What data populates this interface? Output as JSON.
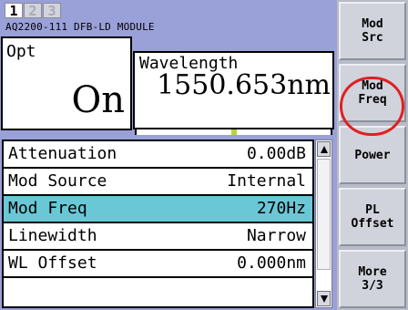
{
  "tabs": [
    {
      "label": "1",
      "active": true
    },
    {
      "label": "2",
      "active": false
    },
    {
      "label": "3",
      "active": false
    }
  ],
  "module_title": "AQ2200-111 DFB-LD MODULE",
  "opt": {
    "label": "Opt",
    "value": "On"
  },
  "wavelength": {
    "label": "Wavelength",
    "value": "1550.653nm"
  },
  "params": [
    {
      "label": "Attenuation",
      "value": "0.00dB",
      "selected": false
    },
    {
      "label": "Mod Source",
      "value": "Internal",
      "selected": false
    },
    {
      "label": "Mod Freq",
      "value": "270Hz",
      "selected": true
    },
    {
      "label": "Linewidth",
      "value": "Narrow",
      "selected": false
    },
    {
      "label": "WL Offset",
      "value": "0.000nm",
      "selected": false
    }
  ],
  "softkeys": [
    {
      "label": "Mod\nSrc"
    },
    {
      "label": "Mod\nFreq",
      "highlighted": true
    },
    {
      "label": "Power"
    },
    {
      "label": "PL\nOffset"
    },
    {
      "label": "More\n3/3"
    }
  ],
  "colors": {
    "panel_background": "#9aa0d8",
    "selected_row": "#6ac8d6",
    "highlight_ring": "#e02020",
    "softkey_face": "#d0d3dc"
  },
  "icons": {
    "scroll_up": "triangle-up-icon",
    "scroll_down": "triangle-down-icon"
  }
}
